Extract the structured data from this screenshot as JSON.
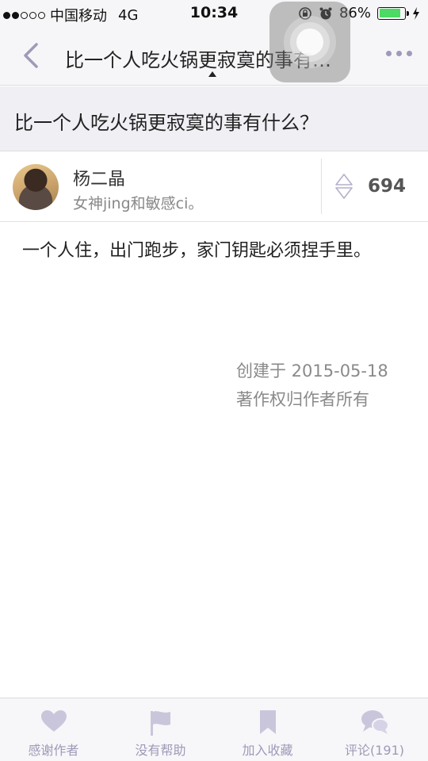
{
  "status_bar": {
    "carrier": "中国移动",
    "network": "4G",
    "time": "10:34",
    "battery_text": "86%",
    "battery_level": 0.86,
    "icons": [
      "signal-dots-icon",
      "orientation-lock-icon",
      "alarm-icon",
      "battery-icon",
      "charging-icon"
    ]
  },
  "nav": {
    "title": "比一个人吃火锅更寂寞的事有…",
    "back_icon": "chevron-left-icon",
    "more_icon": "more-dots-icon"
  },
  "question": {
    "title": "比一个人吃火锅更寂寞的事有什么？"
  },
  "author": {
    "name": "杨二晶",
    "bio": "女神jing和敏感ci。",
    "votes": "694"
  },
  "answer": {
    "content": "一个人住，出门跑步，家门钥匙必须捏手里。",
    "created": "创建于 2015-05-18",
    "copyright": "著作权归作者所有"
  },
  "toolbar": {
    "thank_label": "感谢作者",
    "not_helpful_label": "没有帮助",
    "collect_label": "加入收藏",
    "comments_label": "评论(191)"
  },
  "colors": {
    "accent": "#9e9ab8",
    "nav_background": "#f6f6f8",
    "question_background": "#efeff4",
    "battery_green": "#4cd964"
  }
}
